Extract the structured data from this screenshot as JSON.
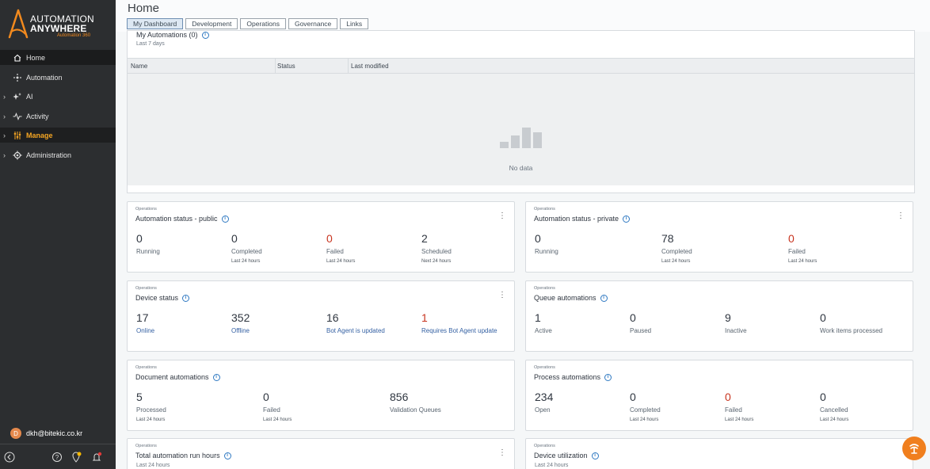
{
  "brand": {
    "line1": "AUTOMATION",
    "line2": "ANYWHERE",
    "line3": "Automation 360",
    "accent": "#f28a1e"
  },
  "sidebar": {
    "items": [
      {
        "label": "Home",
        "icon": "home-icon"
      },
      {
        "label": "Automation",
        "icon": "automation-icon"
      },
      {
        "label": "AI",
        "icon": "ai-icon"
      },
      {
        "label": "Activity",
        "icon": "activity-icon"
      },
      {
        "label": "Manage",
        "icon": "manage-icon"
      },
      {
        "label": "Administration",
        "icon": "gear-icon"
      }
    ],
    "user": {
      "initial": "D",
      "email": "dkh@bitekic.co.kr"
    }
  },
  "header": {
    "title": "Home",
    "tabs": [
      "My Dashboard",
      "Development",
      "Operations",
      "Governance",
      "Links"
    ]
  },
  "my_automations": {
    "title": "My Automations (0)",
    "subtitle": "Last 7 days",
    "columns": [
      "Name",
      "Status",
      "Last modified"
    ],
    "empty": "No data"
  },
  "cards": {
    "status_public": {
      "category": "Operations",
      "title": "Automation status - public",
      "metrics": [
        {
          "value": "0",
          "label": "Running",
          "sub": ""
        },
        {
          "value": "0",
          "label": "Completed",
          "sub": "Last 24 hours"
        },
        {
          "value": "0",
          "label": "Failed",
          "sub": "Last 24 hours"
        },
        {
          "value": "2",
          "label": "Scheduled",
          "sub": "Next 24 hours"
        }
      ]
    },
    "status_private": {
      "category": "Operations",
      "title": "Automation status - private",
      "metrics": [
        {
          "value": "0",
          "label": "Running",
          "sub": ""
        },
        {
          "value": "78",
          "label": "Completed",
          "sub": "Last 24 hours"
        },
        {
          "value": "0",
          "label": "Failed",
          "sub": "Last 24 hours"
        }
      ]
    },
    "device": {
      "category": "Operations",
      "title": "Device status",
      "metrics": [
        {
          "value": "17",
          "label": "Online"
        },
        {
          "value": "352",
          "label": "Offline"
        },
        {
          "value": "16",
          "label": "Bot Agent is updated"
        },
        {
          "value": "1",
          "label": "Requires Bot Agent update"
        }
      ]
    },
    "queue": {
      "category": "Operations",
      "title": "Queue automations",
      "metrics": [
        {
          "value": "1",
          "label": "Active"
        },
        {
          "value": "0",
          "label": "Paused"
        },
        {
          "value": "9",
          "label": "Inactive"
        },
        {
          "value": "0",
          "label": "Work items processed"
        }
      ]
    },
    "document": {
      "category": "Operations",
      "title": "Document automations",
      "metrics": [
        {
          "value": "5",
          "label": "Processed",
          "sub": "Last 24 hours"
        },
        {
          "value": "0",
          "label": "Failed",
          "sub": "Last 24 hours"
        },
        {
          "value": "856",
          "label": "Validation Queues",
          "sub": ""
        }
      ]
    },
    "process": {
      "category": "Operations",
      "title": "Process automations",
      "metrics": [
        {
          "value": "234",
          "label": "Open",
          "sub": ""
        },
        {
          "value": "0",
          "label": "Completed",
          "sub": "Last 24 hours"
        },
        {
          "value": "0",
          "label": "Failed",
          "sub": "Last 24 hours"
        },
        {
          "value": "0",
          "label": "Cancelled",
          "sub": "Last 24 hours"
        }
      ]
    },
    "run_hours": {
      "category": "Operations",
      "title": "Total automation run hours",
      "sub": "Last 24 hours"
    },
    "utilization": {
      "category": "Operations",
      "title": "Device utilization",
      "sub": "Last 24 hours"
    }
  },
  "colors": {
    "sidebar_bg": "#2c2e30",
    "failed_red": "#c8341f",
    "link_blue": "#3561a3",
    "help_orange": "#f07f1e"
  }
}
